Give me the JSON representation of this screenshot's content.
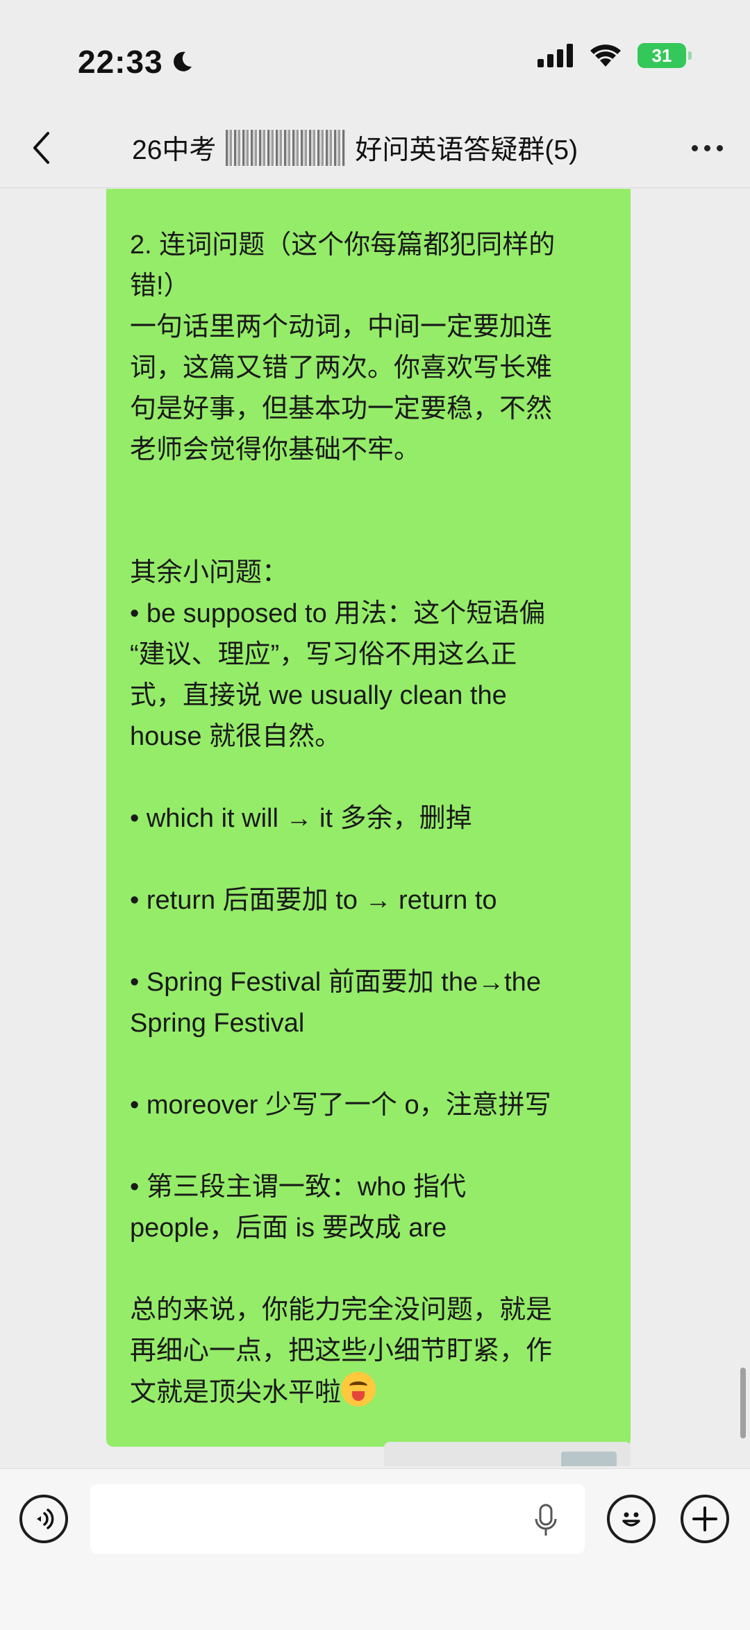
{
  "status_bar": {
    "time": "22:33",
    "battery": "31"
  },
  "header": {
    "title_prefix": "26中考",
    "title_suffix": "好问英语答疑群(5)"
  },
  "message": {
    "lines": [
      "2. 连词问题（这个你每篇都犯同样的",
      "错!）",
      "一句话里两个动词，中间一定要加连",
      "词，这篇又错了两次。你喜欢写长难",
      "句是好事，但基本功一定要稳，不然",
      "老师会觉得你基础不牢。",
      "其余小问题：",
      "• be supposed to 用法：这个短语偏",
      "“建议、理应”，写习俗不用这么正",
      "式，直接说 we usually clean the",
      "house 就很自然。",
      "• which it will → it 多余，删掉",
      "• return 后面要加 to → return to",
      "• Spring Festival 前面要加 the→the",
      "Spring Festival",
      "• moreover 少写了一个 o，注意拼写",
      "• 第三段主谓一致：who 指代",
      "people，后面 is 要改成 are",
      "总的来说，你能力完全没问题，就是",
      "再细心一点，把这些小细节盯紧，作",
      "文就是顶尖水平啦"
    ]
  },
  "colors": {
    "bubble": "#95ec69",
    "background": "#ededed"
  }
}
